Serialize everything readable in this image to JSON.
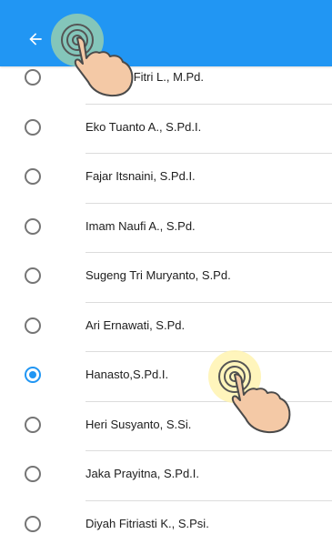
{
  "toolbar": {
    "background": "#2196f3",
    "back_icon": "arrow-left-icon"
  },
  "teachers": [
    {
      "name": "Irmawati Fitri L., M.Pd.",
      "selected": false
    },
    {
      "name": "Eko Tuanto A., S.Pd.I.",
      "selected": false
    },
    {
      "name": "Fajar Itsnaini, S.Pd.I.",
      "selected": false
    },
    {
      "name": "Imam Naufi A., S.Pd.",
      "selected": false
    },
    {
      "name": "Sugeng Tri Muryanto, S.Pd.",
      "selected": false
    },
    {
      "name": "Ari Ernawati, S.Pd.",
      "selected": false
    },
    {
      "name": "Hanasto,S.Pd.I.",
      "selected": true
    },
    {
      "name": "Heri Susyanto, S.Si.",
      "selected": false
    },
    {
      "name": "Jaka Prayitna, S.Pd.I.",
      "selected": false
    },
    {
      "name": "Diyah Fitriasti K., S.Psi.",
      "selected": false
    }
  ],
  "accent_color": "#2196f3"
}
